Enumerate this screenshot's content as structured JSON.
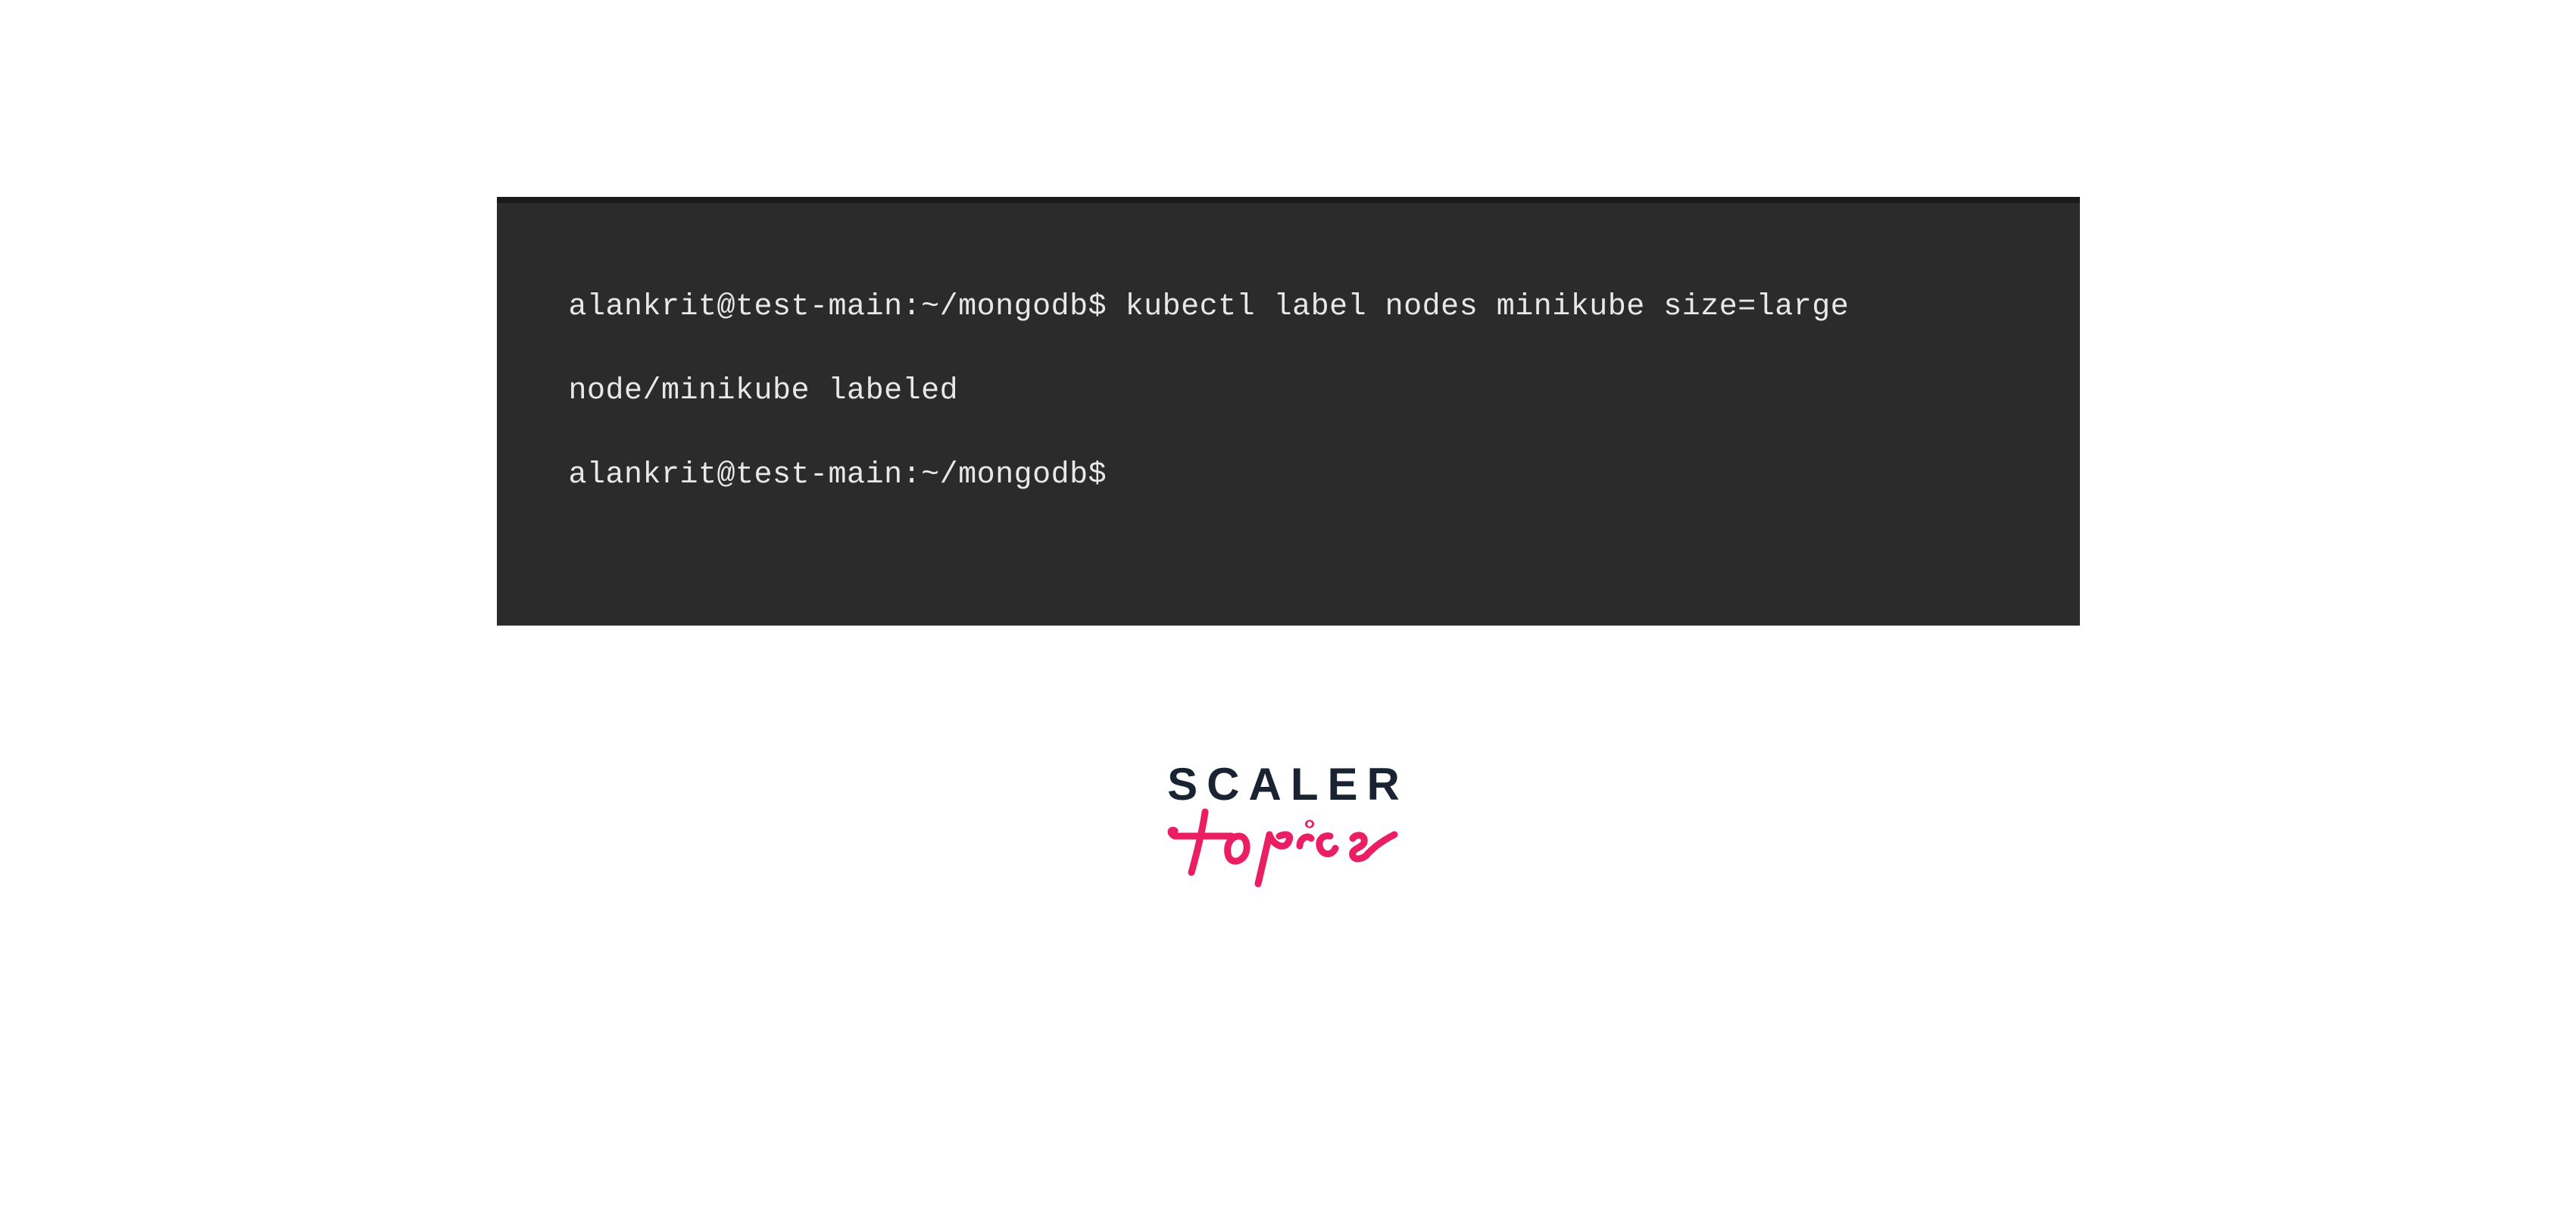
{
  "terminal": {
    "lines": [
      "alankrit@test-main:~/mongodb$ kubectl label nodes minikube size=large",
      "node/minikube labeled",
      "alankrit@test-main:~/mongodb$"
    ]
  },
  "logo": {
    "scaler": "SCALER",
    "topics": "Topics"
  },
  "colors": {
    "terminal_bg": "#2b2b2b",
    "terminal_text": "#e8e8e8",
    "logo_dark": "#1a2332",
    "logo_pink": "#e91e63"
  }
}
